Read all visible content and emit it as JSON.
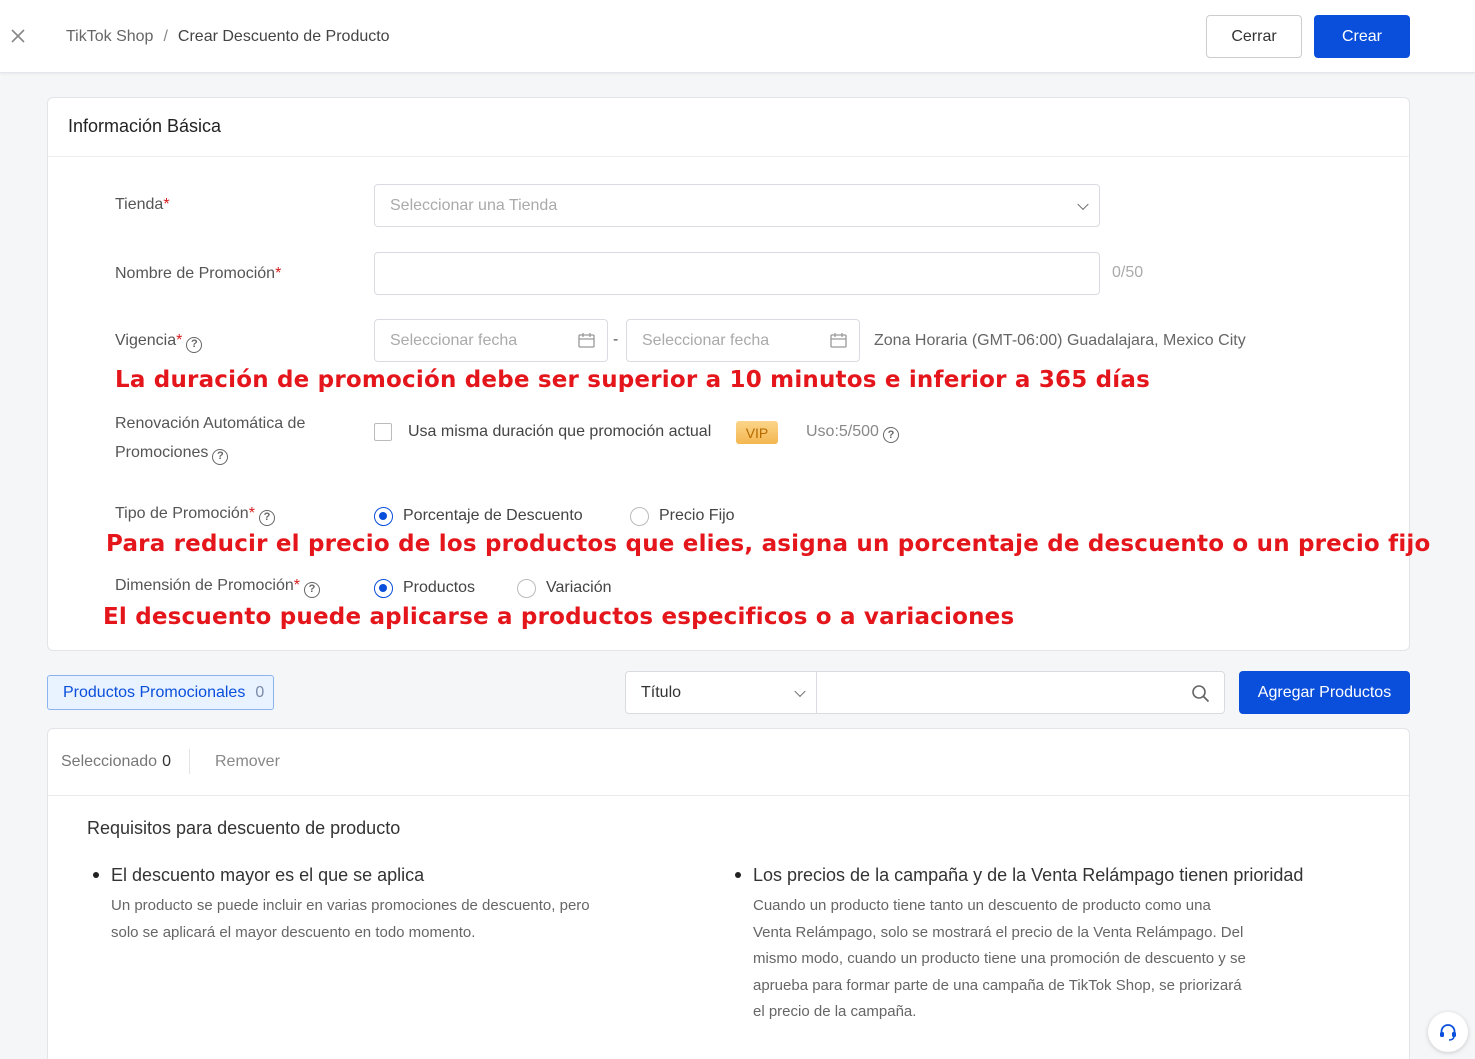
{
  "header": {
    "breadcrumb_root": "TikTok Shop",
    "breadcrumb_sep": "/",
    "breadcrumb_current": "Crear Descuento de Producto",
    "close_label": "Cerrar",
    "create_label": "Crear"
  },
  "basic_info": {
    "title": "Información Básica",
    "store": {
      "label": "Tienda",
      "placeholder": "Seleccionar una Tienda"
    },
    "name": {
      "label": "Nombre de Promoción",
      "value": "",
      "counter": "0/50"
    },
    "validity": {
      "label": "Vigencia",
      "start_placeholder": "Seleccionar fecha",
      "end_placeholder": "Seleccionar fecha",
      "separator": "-",
      "timezone": "Zona Horaria (GMT-06:00) Guadalajara, Mexico City"
    },
    "renewal": {
      "label_line1": "Renovación Automática de",
      "label_line2": "Promociones",
      "checkbox_label": "Usa misma duración que promoción actual",
      "vip": "VIP",
      "usage": "Uso:5/500"
    },
    "promo_type": {
      "label": "Tipo de Promoción",
      "options": [
        "Porcentaje de Descuento",
        "Precio Fijo"
      ],
      "selected": "Porcentaje de Descuento"
    },
    "dimension": {
      "label": "Dimensión de Promoción",
      "options": [
        "Productos",
        "Variación"
      ],
      "selected": "Productos"
    },
    "required_mark": "*",
    "help_glyph": "?"
  },
  "annotations": {
    "duration": "La duración de promoción debe ser superior a 10 minutos e inferior a 365 días",
    "type": "Para reducir el precio de los productos que elies, asigna un porcentaje de descuento o un precio fijo",
    "dimension": "El descuento puede aplicarse a productos especificos o a variaciones"
  },
  "products_bar": {
    "tab_label": "Productos Promocionales",
    "tab_count": "0",
    "filter_value": "Título",
    "search_value": "",
    "add_label": "Agregar Productos"
  },
  "products_panel": {
    "selected_label": "Seleccionado",
    "selected_count": "0",
    "remove_label": "Remover",
    "requirements_title": "Requisitos para descuento de producto",
    "req1_title": "El descuento mayor es el que se aplica",
    "req1_lines": [
      "Un producto se puede incluir en varias promociones de descuento, pero",
      "solo se aplicará el mayor descuento en todo momento."
    ],
    "req2_title": "Los precios de la campaña y de la Venta Relámpago tienen prioridad",
    "req2_lines": [
      "Cuando un producto tiene tanto un descuento de producto como una",
      "Venta Relámpago, solo se mostrará el precio de la Venta Relámpago. Del",
      "mismo modo, cuando un producto tiene una promoción de descuento y se",
      "aprueba para formar parte de una campaña de TikTok Shop, se priorizará",
      "el precio de la campaña."
    ]
  },
  "colors": {
    "primary": "#0a4fdb",
    "annotation_red": "#e4161c",
    "required_red": "#d91b1b"
  },
  "icons": [
    "close-icon",
    "chevron-down-icon",
    "calendar-icon",
    "help-icon",
    "search-icon",
    "headset-icon"
  ]
}
